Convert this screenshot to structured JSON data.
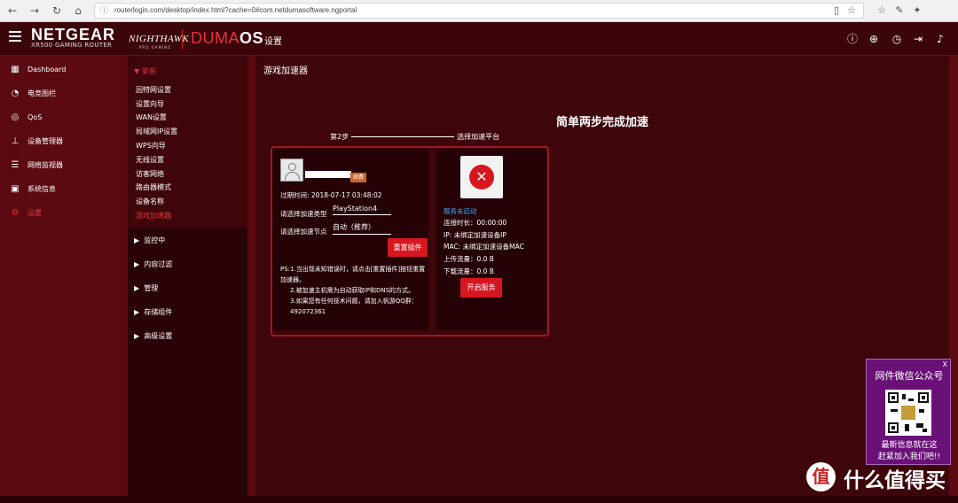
{
  "browser": {
    "url": "routerlogin.com/desktop/index.html?cache=0#com.netdumasoftware.ngportal"
  },
  "header": {
    "brand": "NETGEAR",
    "model": "XR500 GAMING ROUTER",
    "nighthawk": "NIGHTHAWK",
    "pro_gaming": "PRO GAMING",
    "duma": "DUMA",
    "os": "OS",
    "title": "设置"
  },
  "sidebar": {
    "items": [
      {
        "label": "Dashboard",
        "icon": "dashboard-icon"
      },
      {
        "label": "电竞图栏",
        "icon": "gauge-icon"
      },
      {
        "label": "QoS",
        "icon": "qos-icon"
      },
      {
        "label": "设备管理器",
        "icon": "device-tree-icon"
      },
      {
        "label": "网络监视器",
        "icon": "monitor-icon"
      },
      {
        "label": "系统信息",
        "icon": "system-info-icon"
      },
      {
        "label": "设置",
        "icon": "settings-icon"
      }
    ]
  },
  "subpanel": {
    "section": "安装",
    "items": [
      "因特网设置",
      "设置向导",
      "WAN设置",
      "局域网IP设置",
      "WPS向导",
      "无线设置",
      "访客网络",
      "路由器模式",
      "设备名称",
      "游戏加速器"
    ],
    "categories": [
      "监控中",
      "内容过滤",
      "管理",
      "存储组件",
      "高级设置"
    ]
  },
  "content": {
    "title": "游戏加速器",
    "heading": "简单两步完成加速",
    "step_label": "第2步",
    "step_text": "选择加速平台",
    "left_card": {
      "renew": "续费",
      "expire": "过期时间: 2018-07-17 03:48:02",
      "type_label": "请选择加速类型",
      "type_value": "PlayStation4",
      "node_label": "请选择加速节点",
      "node_value": "自动（推荐）",
      "reset_button": "重置插件",
      "note1": "PS:1.当出现未知错误时，请点击[重置插件]按钮重置加速器。",
      "note2": "2.被加速主机需为自动获取IP和DNS的方式。",
      "note3": "3.如果您有任何技术问题，请加入帆游QQ群：492072361"
    },
    "right_card": {
      "status": "服务未启动",
      "duration": "连接时长：00:00:00",
      "ip": "IP: 未绑定加速设备IP",
      "mac": "MAC: 未绑定加速设备MAC",
      "upload": "上传流量：0.0 B",
      "download": "下载流量：0.0 B",
      "start_button": "开启服务"
    }
  },
  "wechat_popup": {
    "close": "X",
    "title": "网件微信公众号",
    "line1": "最新信息就在这",
    "line2": "赶紧加入我们吧!!"
  },
  "watermark": {
    "logo": "值",
    "text": "什么值得买"
  }
}
